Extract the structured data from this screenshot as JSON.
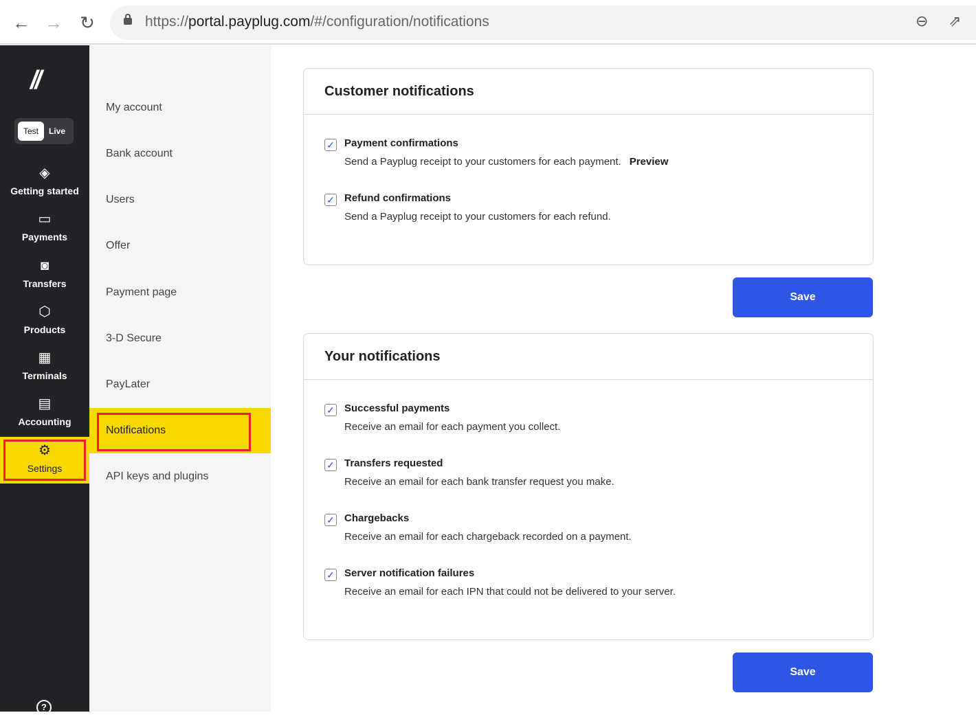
{
  "browser": {
    "url_prefix": "https://",
    "url_host": "portal.payplug.com",
    "url_path": "/#/configuration/notifications",
    "back": "←",
    "forward": "→",
    "reload": "↻",
    "zoom_icon": "zoom-out-icon",
    "share_icon": "share-icon"
  },
  "sidebar": {
    "logo": "//",
    "toggle": {
      "test": "Test",
      "live": "Live"
    },
    "items": [
      {
        "label": "Getting started",
        "icon": "layers-icon",
        "glyph": "◈"
      },
      {
        "label": "Payments",
        "icon": "card-icon",
        "glyph": "▭"
      },
      {
        "label": "Transfers",
        "icon": "cash-icon",
        "glyph": "◙"
      },
      {
        "label": "Products",
        "icon": "box-icon",
        "glyph": "⬡"
      },
      {
        "label": "Terminals",
        "icon": "terminal-icon",
        "glyph": "▦"
      },
      {
        "label": "Accounting",
        "icon": "receipt-icon",
        "glyph": "▤"
      },
      {
        "label": "Settings",
        "icon": "gear-icon",
        "glyph": "⚙"
      }
    ],
    "help": "?"
  },
  "submenu": {
    "items": [
      "My account",
      "Bank account",
      "Users",
      "Offer",
      "Payment page",
      "3-D Secure",
      "PayLater",
      "Notifications",
      "API keys and plugins"
    ],
    "active": "Notifications"
  },
  "customer": {
    "title": "Customer notifications",
    "options": [
      {
        "title": "Payment confirmations",
        "desc": "Send a Payplug receipt to your customers for each payment.",
        "link": "Preview",
        "checked": true
      },
      {
        "title": "Refund confirmations",
        "desc": "Send a Payplug receipt to your customers for each refund.",
        "checked": true
      }
    ],
    "save": "Save"
  },
  "yours": {
    "title": "Your notifications",
    "options": [
      {
        "title": "Successful payments",
        "desc": "Receive an email for each payment you collect.",
        "checked": true
      },
      {
        "title": "Transfers requested",
        "desc": "Receive an email for each bank transfer request you make.",
        "checked": true
      },
      {
        "title": "Chargebacks",
        "desc": "Receive an email for each chargeback recorded on a payment.",
        "checked": true
      },
      {
        "title": "Server notification failures",
        "desc": "Receive an email for each IPN that could not be delivered to your server.",
        "checked": true
      }
    ],
    "save": "Save"
  },
  "colors": {
    "accent": "#2f55e4",
    "highlight": "#f7d900",
    "annotation": "#e8222a",
    "sidebar": "#222326"
  }
}
